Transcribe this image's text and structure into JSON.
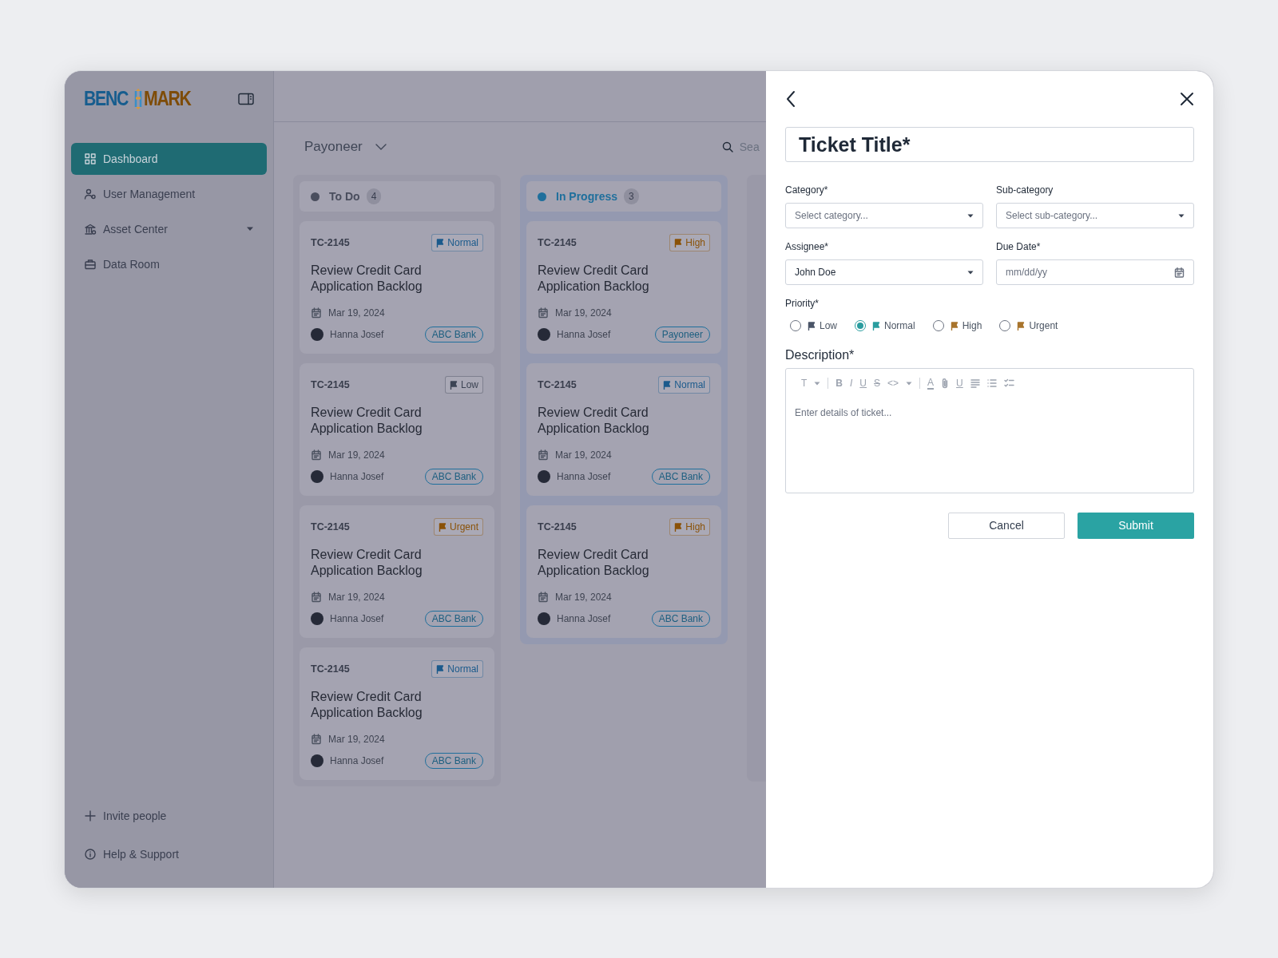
{
  "logo": {
    "left": "BENC",
    "right": "MARK"
  },
  "sidebar": {
    "items": [
      {
        "label": "Dashboard",
        "selected": true,
        "kind": "grid"
      },
      {
        "label": "User Management",
        "selected": false,
        "kind": "users"
      },
      {
        "label": "Asset Center",
        "selected": false,
        "kind": "bank",
        "expanded": false
      },
      {
        "label": "Data Room",
        "selected": false,
        "kind": "briefcase"
      }
    ],
    "footer": [
      {
        "label": "Invite people",
        "kind": "plus"
      },
      {
        "label": "Help & Support",
        "kind": "info"
      }
    ]
  },
  "board": {
    "workspace": "Payoneer",
    "search": {
      "placeholder": "Sea"
    },
    "columns": [
      {
        "title": "To Do",
        "count": "4",
        "color": "#4a4e5e",
        "cards": [
          {
            "id": "TC-2145",
            "priority": {
              "label": "Normal",
              "color": "#1b5a8c"
            },
            "title": "Review Credit Card Application Backlog",
            "date": "Mar 19, 2024",
            "assignee": "Hanna Josef",
            "bank": "ABC Bank"
          },
          {
            "id": "TC-2145",
            "priority": {
              "label": "Low",
              "color": "#3d4454"
            },
            "title": "Review Credit Card Application Backlog",
            "date": "Mar 19, 2024",
            "assignee": "Hanna Josef",
            "bank": "ABC Bank"
          },
          {
            "id": "TC-2145",
            "priority": {
              "label": "Urgent",
              "color": "#8a5208"
            },
            "title": "Review Credit Card Application Backlog",
            "date": "Mar 19, 2024",
            "assignee": "Hanna Josef",
            "bank": "ABC Bank"
          },
          {
            "id": "TC-2145",
            "priority": {
              "label": "Normal",
              "color": "#1b5a8c"
            },
            "title": "Review Credit Card Application Backlog",
            "date": "Mar 19, 2024",
            "assignee": "Hanna Josef",
            "bank": "ABC Bank"
          }
        ]
      },
      {
        "title": "In Progress",
        "count": "3",
        "color": "#1f6f9c",
        "cards": [
          {
            "id": "TC-2145",
            "priority": {
              "label": "High",
              "color": "#8a5208"
            },
            "title": "Review Credit Card Application Backlog",
            "date": "Mar 19, 2024",
            "assignee": "Hanna Josef",
            "bank": "Payoneer"
          },
          {
            "id": "TC-2145",
            "priority": {
              "label": "Normal",
              "color": "#1b5a8c"
            },
            "title": "Review Credit Card Application Backlog",
            "date": "Mar 19, 2024",
            "assignee": "Hanna Josef",
            "bank": "ABC Bank"
          },
          {
            "id": "TC-2145",
            "priority": {
              "label": "High",
              "color": "#8a5208"
            },
            "title": "Review Credit Card Application Backlog",
            "date": "Mar 19, 2024",
            "assignee": "Hanna Josef",
            "bank": "ABC Bank"
          }
        ]
      }
    ]
  },
  "drawer": {
    "title": {
      "placeholder": "Ticket Title*"
    },
    "fields": [
      {
        "label": "Category*",
        "kind": "select",
        "placeholder": "Select category..."
      },
      {
        "label": "Sub-category",
        "kind": "select",
        "placeholder": "Select sub-category..."
      },
      {
        "label": "Assignee*",
        "kind": "select",
        "value": "John Doe"
      },
      {
        "label": "Due Date*",
        "kind": "date",
        "placeholder": "mm/dd/yy"
      }
    ],
    "priority": {
      "label": "Priority*",
      "options": [
        {
          "label": "Low",
          "color": "#4b5568",
          "selected": false
        },
        {
          "label": "Normal",
          "color": "#2a9d9f",
          "selected": true
        },
        {
          "label": "High",
          "color": "#a8742c",
          "selected": false
        },
        {
          "label": "Urgent",
          "color": "#a8742c",
          "selected": false
        }
      ]
    },
    "description": {
      "label": "Description*",
      "placeholder": "Enter details of ticket...",
      "toolbar": [
        {
          "kind": "text",
          "label": "T"
        },
        {
          "kind": "caret"
        },
        {
          "kind": "divider"
        },
        {
          "kind": "bold",
          "label": "B"
        },
        {
          "kind": "italic",
          "label": "I"
        },
        {
          "kind": "underline",
          "label": "U"
        },
        {
          "kind": "strike",
          "label": "S"
        },
        {
          "kind": "text",
          "label": "<>"
        },
        {
          "kind": "caret"
        },
        {
          "kind": "divider"
        },
        {
          "kind": "color",
          "label": "A"
        },
        {
          "kind": "attach"
        },
        {
          "kind": "underline",
          "label": "U"
        },
        {
          "kind": "align"
        },
        {
          "kind": "bullets"
        },
        {
          "kind": "checklist"
        }
      ]
    },
    "buttons": [
      {
        "label": "Cancel",
        "kind": "secondary"
      },
      {
        "label": "Submit",
        "kind": "primary"
      }
    ]
  }
}
